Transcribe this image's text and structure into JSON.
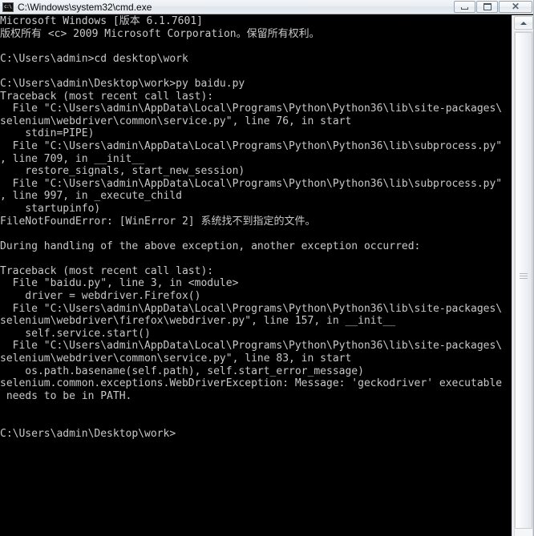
{
  "window": {
    "title": "C:\\Windows\\system32\\cmd.exe",
    "icon": "console-icon",
    "buttons": {
      "minimize": "minimize",
      "maximize": "maximize",
      "close": "✕"
    },
    "colors": {
      "console_background": "#000000",
      "console_text": "#c8c8c8",
      "titlebar": "#e9edf2",
      "scrollbar_track": "#f4f6f8"
    }
  },
  "scrollbar": {
    "up_arrow": "scroll-up",
    "thumb": "scroll-thumb"
  },
  "console": {
    "lines": [
      "Microsoft Windows [版本 6.1.7601]",
      "版权所有 <c> 2009 Microsoft Corporation。保留所有权利。",
      "",
      "C:\\Users\\admin>cd desktop\\work",
      "",
      "C:\\Users\\admin\\Desktop\\work>py baidu.py",
      "Traceback (most recent call last):",
      "  File \"C:\\Users\\admin\\AppData\\Local\\Programs\\Python\\Python36\\lib\\site-packages\\",
      "selenium\\webdriver\\common\\service.py\", line 76, in start",
      "    stdin=PIPE)",
      "  File \"C:\\Users\\admin\\AppData\\Local\\Programs\\Python\\Python36\\lib\\subprocess.py\"",
      ", line 709, in __init__",
      "    restore_signals, start_new_session)",
      "  File \"C:\\Users\\admin\\AppData\\Local\\Programs\\Python\\Python36\\lib\\subprocess.py\"",
      ", line 997, in _execute_child",
      "    startupinfo)",
      "FileNotFoundError: [WinError 2] 系统找不到指定的文件。",
      "",
      "During handling of the above exception, another exception occurred:",
      "",
      "Traceback (most recent call last):",
      "  File \"baidu.py\", line 3, in <module>",
      "    driver = webdriver.Firefox()",
      "  File \"C:\\Users\\admin\\AppData\\Local\\Programs\\Python\\Python36\\lib\\site-packages\\",
      "selenium\\webdriver\\firefox\\webdriver.py\", line 157, in __init__",
      "    self.service.start()",
      "  File \"C:\\Users\\admin\\AppData\\Local\\Programs\\Python\\Python36\\lib\\site-packages\\",
      "selenium\\webdriver\\common\\service.py\", line 83, in start",
      "    os.path.basename(self.path), self.start_error_message)",
      "selenium.common.exceptions.WebDriverException: Message: 'geckodriver' executable",
      " needs to be in PATH.",
      "",
      "",
      "C:\\Users\\admin\\Desktop\\work>"
    ]
  }
}
